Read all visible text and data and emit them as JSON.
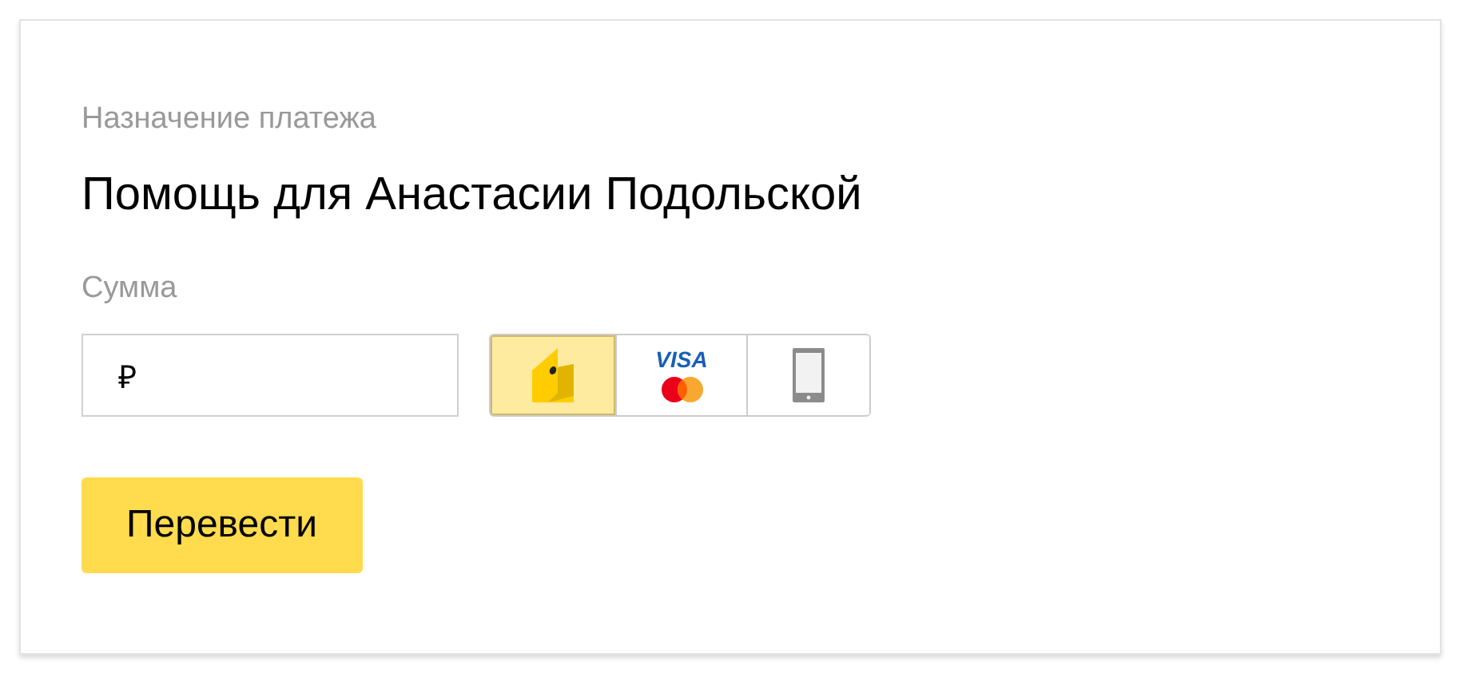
{
  "purpose": {
    "label": "Назначение платежа",
    "value": "Помощь для Анастасии Подольской"
  },
  "amount": {
    "label": "Сумма",
    "currency": "₽"
  },
  "methods": [
    {
      "kind": "wallet",
      "selected": true
    },
    {
      "kind": "card",
      "label": "VISA",
      "selected": false
    },
    {
      "kind": "phone",
      "selected": false
    }
  ],
  "submit": "Перевести"
}
